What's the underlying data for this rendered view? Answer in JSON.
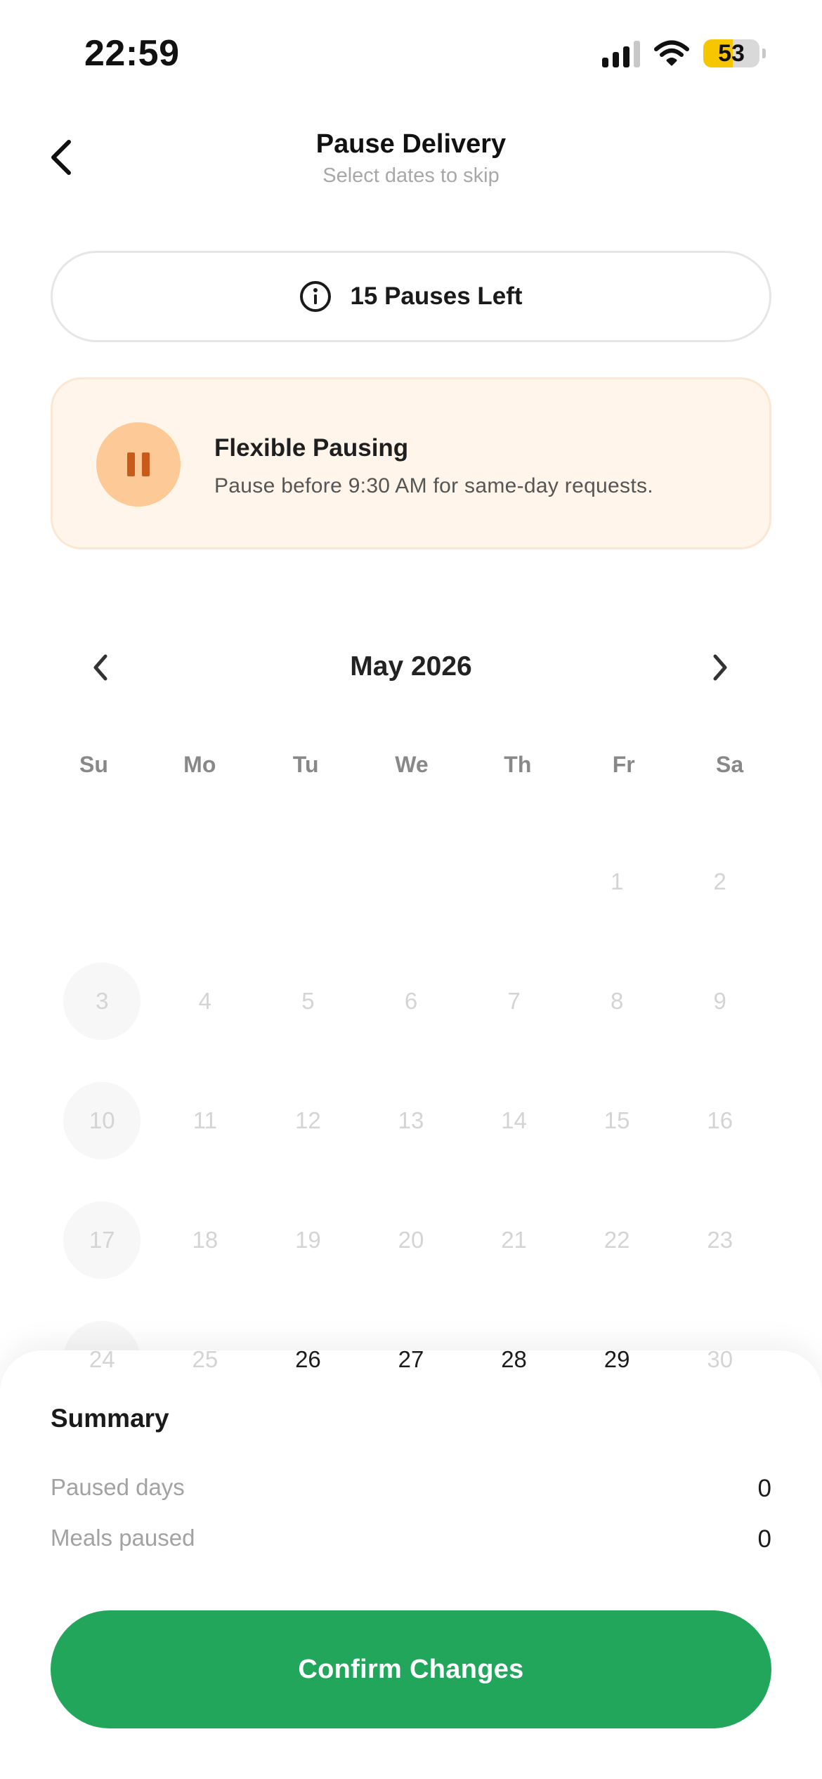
{
  "status_bar": {
    "time": "22:59",
    "battery_level": "53",
    "battery_fill_fraction": 0.53,
    "battery_color": "#f6c700",
    "signal_icon": "cellular-signal-icon",
    "wifi_icon": "wifi-icon"
  },
  "header": {
    "back_icon": "chevron-left-icon",
    "title": "Pause Delivery",
    "subtitle": "Select dates to skip"
  },
  "pauses": {
    "icon": "info-icon",
    "label": "15 Pauses Left"
  },
  "flex_card": {
    "icon": "pause-icon",
    "title": "Flexible Pausing",
    "description": "Pause before 9:30 AM for same-day requests.",
    "background_color": "#fff5ea",
    "icon_color": "#c85a1a"
  },
  "calendar": {
    "month_label": "May 2026",
    "prev_icon": "chevron-left-icon",
    "next_icon": "chevron-right-icon",
    "weekdays": [
      "Su",
      "Mo",
      "Tu",
      "We",
      "Th",
      "Fr",
      "Sa"
    ],
    "leading_blank_days": 5,
    "days": [
      {
        "label": "1",
        "state": "disabled"
      },
      {
        "label": "2",
        "state": "disabled"
      },
      {
        "label": "3",
        "state": "disabled-sunday"
      },
      {
        "label": "4",
        "state": "disabled"
      },
      {
        "label": "5",
        "state": "disabled"
      },
      {
        "label": "6",
        "state": "disabled"
      },
      {
        "label": "7",
        "state": "disabled"
      },
      {
        "label": "8",
        "state": "disabled"
      },
      {
        "label": "9",
        "state": "disabled"
      },
      {
        "label": "10",
        "state": "disabled-sunday"
      },
      {
        "label": "11",
        "state": "disabled"
      },
      {
        "label": "12",
        "state": "disabled"
      },
      {
        "label": "13",
        "state": "disabled"
      },
      {
        "label": "14",
        "state": "disabled"
      },
      {
        "label": "15",
        "state": "disabled"
      },
      {
        "label": "16",
        "state": "disabled"
      },
      {
        "label": "17",
        "state": "disabled-sunday"
      },
      {
        "label": "18",
        "state": "disabled"
      },
      {
        "label": "19",
        "state": "disabled"
      },
      {
        "label": "20",
        "state": "disabled"
      },
      {
        "label": "21",
        "state": "disabled"
      },
      {
        "label": "22",
        "state": "disabled"
      },
      {
        "label": "23",
        "state": "disabled"
      },
      {
        "label": "24",
        "state": "disabled-sunday"
      },
      {
        "label": "25",
        "state": "disabled"
      },
      {
        "label": "26",
        "state": "available"
      },
      {
        "label": "27",
        "state": "available"
      },
      {
        "label": "28",
        "state": "available"
      },
      {
        "label": "29",
        "state": "available"
      },
      {
        "label": "30",
        "state": "disabled"
      }
    ]
  },
  "summary": {
    "title": "Summary",
    "rows": [
      {
        "label": "Paused days",
        "value": "0"
      },
      {
        "label": "Meals paused",
        "value": "0"
      }
    ],
    "confirm_label": "Confirm Changes",
    "confirm_color": "#22a65b"
  }
}
